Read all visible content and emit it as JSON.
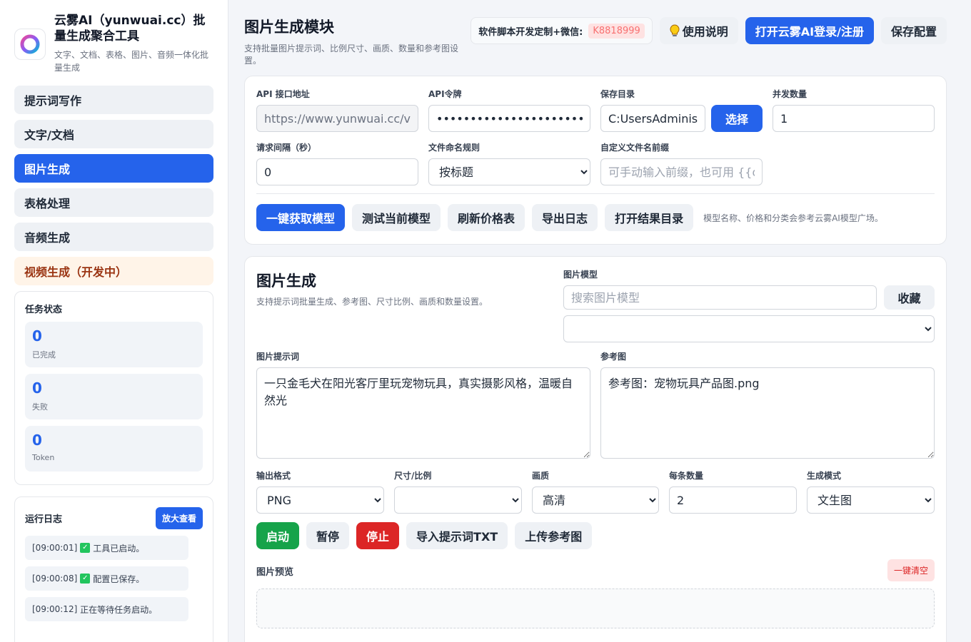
{
  "app": {
    "title": "云雾AI（yunwuai.cc）批量生成聚合工具",
    "subtitle": "文字、文档、表格、图片、音频一体化批量生成"
  },
  "nav": {
    "items": [
      {
        "label": "提示词写作"
      },
      {
        "label": "文字/文档"
      },
      {
        "label": "图片生成"
      },
      {
        "label": "表格处理"
      },
      {
        "label": "音频生成"
      },
      {
        "label": "视频生成（开发中）"
      }
    ],
    "active_index": 2
  },
  "status": {
    "title": "任务状态",
    "completed": {
      "value": "0",
      "label": "已完成"
    },
    "failed": {
      "value": "0",
      "label": "失败"
    },
    "token": {
      "value": "0",
      "label": "Token"
    }
  },
  "log": {
    "title": "运行日志",
    "zoom_label": "放大查看",
    "lines": [
      {
        "time": "[09:00:01]",
        "check": "✓",
        "text": "工具已启动。"
      },
      {
        "time": "[09:00:08]",
        "check": "✓",
        "text": "配置已保存。"
      },
      {
        "time": "[09:00:12]",
        "text": "正在等待任务启动。"
      }
    ]
  },
  "header": {
    "title": "图片生成模块",
    "subtitle": "支持批量图片提示词、比例尺寸、画质、数量和参考图设置。",
    "contact_label": "软件脚本开发定制+微信:",
    "contact_id": "K8818999",
    "help_label": "使用说明",
    "login_label": "打开云雾AI登录/注册",
    "save_label": "保存配置"
  },
  "config": {
    "api_url": {
      "label": "API 接口地址",
      "value": "https://www.yunwuai.cc/v1"
    },
    "api_token": {
      "label": "API令牌",
      "value": "••••••••••••••••••••••••"
    },
    "save_dir": {
      "label": "保存目录",
      "value": "C:UsersAdminist",
      "button": "选择"
    },
    "concurrency": {
      "label": "并发数量",
      "value": "1"
    },
    "interval": {
      "label": "请求间隔（秒）",
      "value": "0"
    },
    "naming": {
      "label": "文件命名规则",
      "value": "按标题"
    },
    "prefix": {
      "label": "自定义文件名前缀",
      "placeholder": "可手动输入前缀，也可用 {{date}}"
    },
    "actions": {
      "fetch": "一键获取模型",
      "test": "测试当前模型",
      "refresh": "刷新价格表",
      "export": "导出日志",
      "open_dir": "打开结果目录",
      "hint": "模型名称、价格和分类会参考云雾AI模型广场。"
    }
  },
  "gen": {
    "title": "图片生成",
    "subtitle": "支持提示词批量生成、参考图、尺寸比例、画质和数量设置。",
    "model": {
      "label": "图片模型",
      "placeholder": "搜索图片模型",
      "fav": "收藏",
      "selected": ""
    },
    "prompt": {
      "label": "图片提示词",
      "value": "一只金毛犬在阳光客厅里玩宠物玩具，真实摄影风格，温暖自然光"
    },
    "ref": {
      "label": "参考图",
      "value": "参考图：宠物玩具产品图.png"
    },
    "format": {
      "label": "输出格式",
      "value": "PNG"
    },
    "size": {
      "label": "尺寸/比例",
      "value": ""
    },
    "quality": {
      "label": "画质",
      "value": "高清"
    },
    "count": {
      "label": "每条数量",
      "value": "2"
    },
    "mode": {
      "label": "生成模式",
      "value": "文生图"
    },
    "buttons": {
      "start": "启动",
      "pause": "暂停",
      "stop": "停止",
      "import": "导入提示词TXT",
      "upload": "上传参考图"
    },
    "preview": {
      "label": "图片预览",
      "clear": "一键清空"
    }
  },
  "colors": {
    "primary": "#2563eb",
    "success": "#16a34a",
    "danger": "#dc2626"
  }
}
